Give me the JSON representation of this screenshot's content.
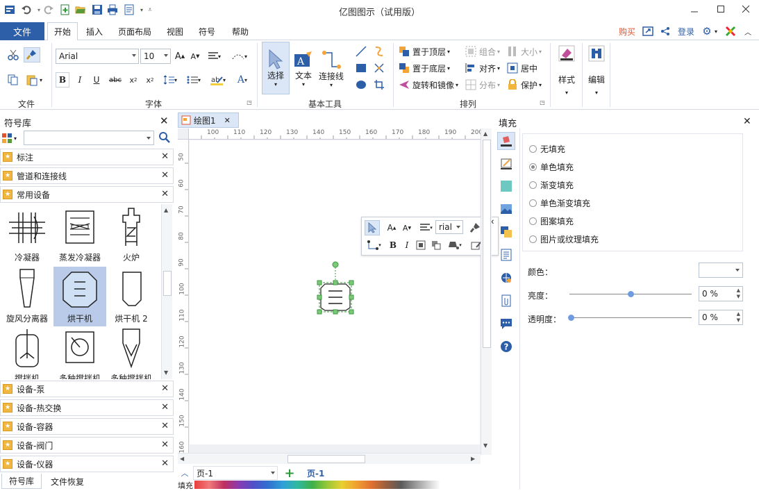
{
  "app": {
    "title": "亿图图示（试用版）"
  },
  "menu": {
    "file": "文件",
    "tabs": [
      "开始",
      "插入",
      "页面布局",
      "视图",
      "符号",
      "帮助"
    ],
    "buy": "购买",
    "login": "登录"
  },
  "ribbon": {
    "groups": {
      "file": "文件",
      "font": "字体",
      "basic_tools": "基本工具",
      "arrange": "排列",
      "style": "样式",
      "edit": "编辑"
    },
    "font_name": "Arial",
    "font_size": "10",
    "tools": {
      "select": "选择",
      "text": "文本",
      "connector": "连接线"
    },
    "arrange": {
      "bring_front": "置于顶层",
      "send_back": "置于底层",
      "rotate_mirror": "旋转和镜像",
      "group": "组合",
      "align": "对齐",
      "distribute": "分布",
      "size": "大小",
      "center": "居中",
      "protect": "保护"
    }
  },
  "library": {
    "title": "符号库",
    "search_placeholder": "",
    "categories_top": [
      "标注",
      "管道和连接线",
      "常用设备"
    ],
    "symbols": [
      "冷凝器",
      "蒸发冷凝器",
      "火炉",
      "旋风分离器",
      "烘干机",
      "烘干机 2",
      "搅拌机",
      "多种搅拌机",
      "多种搅拌机"
    ],
    "categories_bottom": [
      "设备-泵",
      "设备-热交换",
      "设备-容器",
      "设备-阀门",
      "设备-仪器"
    ],
    "bottom_tabs": [
      "符号库",
      "文件恢复"
    ]
  },
  "document": {
    "tab": "绘图1",
    "ruler_h": [
      "100",
      "110",
      "120",
      "130",
      "140",
      "150",
      "160",
      "170",
      "180",
      "190",
      "200"
    ],
    "ruler_v": [
      "50",
      "60",
      "70",
      "80",
      "90",
      "100",
      "110",
      "120",
      "130",
      "140",
      "150",
      "160"
    ],
    "float_font": "rial"
  },
  "pages": {
    "current": "页-1",
    "tab": "页-1",
    "fill_label": "填充"
  },
  "fill_panel": {
    "title": "填充",
    "options": [
      "无填充",
      "单色填充",
      "渐变填充",
      "单色渐变填充",
      "图案填充",
      "图片或纹理填充"
    ],
    "selected": "单色填充",
    "color_label": "颜色：",
    "brightness_label": "亮度：",
    "brightness_value": "0 %",
    "transparency_label": "透明度：",
    "transparency_value": "0 %"
  },
  "colors": {
    "accent": "#2d5fa8",
    "selected_symbol": "#b9cbe8",
    "buy": "#e0532f"
  }
}
